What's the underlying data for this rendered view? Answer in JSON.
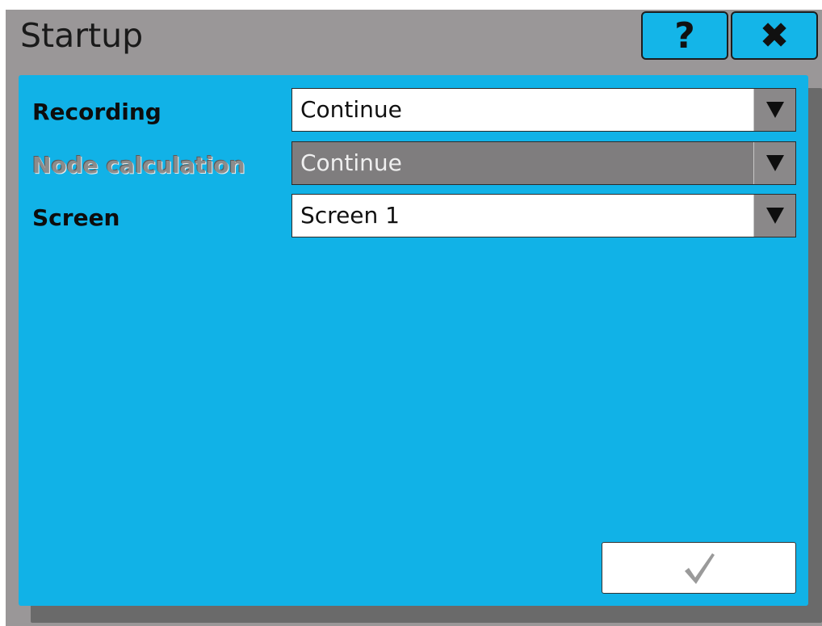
{
  "window": {
    "title": "Startup"
  },
  "header": {
    "help_label": "?",
    "close_label": "✖"
  },
  "fields": [
    {
      "label": "Recording",
      "value": "Continue",
      "enabled": true
    },
    {
      "label": "Node calculation",
      "value": "Continue",
      "enabled": false
    },
    {
      "label": "Screen",
      "value": "Screen 1",
      "enabled": true
    }
  ],
  "footer": {
    "confirm_icon": "checkmark-icon"
  },
  "colors": {
    "panel": "#11b2e7",
    "window_bg": "#9a9798",
    "header_button": "#14b5e8",
    "disabled_select": "#7f7d7e"
  }
}
